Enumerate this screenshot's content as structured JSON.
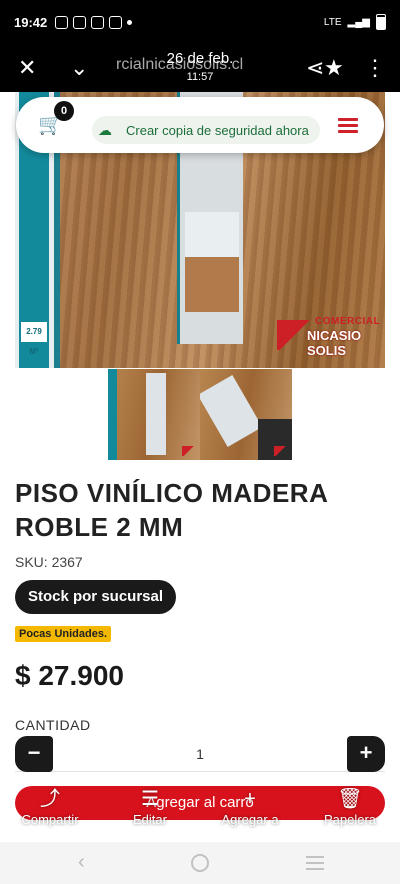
{
  "status_bar": {
    "time": "19:42",
    "network": "LTE"
  },
  "viewer_bar": {
    "url": "rcialnicasiosolis.cl",
    "date": "26 de feb.",
    "clock": "11:57"
  },
  "toolbar": {
    "cart_count": "0",
    "backup_label": "Crear copia de seguridad ahora",
    "accent": "#d0202a"
  },
  "hero": {
    "logo_line1": "COMERCIAL",
    "logo_line2": "NICASIO SOLIS",
    "box_badge": "2.79 M²"
  },
  "product": {
    "title": "PISO VINÍLICO MADERA ROBLE 2 MM",
    "sku": "SKU: 2367",
    "stock_button": "Stock por sucursal",
    "low_stock_badge": "Pocas Unidades.",
    "price": "$ 27.900",
    "quantity_label": "CANTIDAD",
    "quantity_value": "1",
    "minus_label": "−",
    "plus_label": "+",
    "add_to_cart": "Agregar al carro"
  },
  "bottom_actions": [
    {
      "label": "Compartir",
      "icon": "share-icon",
      "glyph": "⤴"
    },
    {
      "label": "Editar",
      "icon": "edit-icon",
      "glyph": "☰"
    },
    {
      "label": "Agregar a",
      "icon": "add-icon",
      "glyph": "+"
    },
    {
      "label": "Papelera",
      "icon": "trash-icon",
      "glyph": "🗑"
    }
  ],
  "colors": {
    "brand_red": "#d8121c",
    "dark": "#1a1a1a",
    "badge_yellow": "#f5b800"
  }
}
